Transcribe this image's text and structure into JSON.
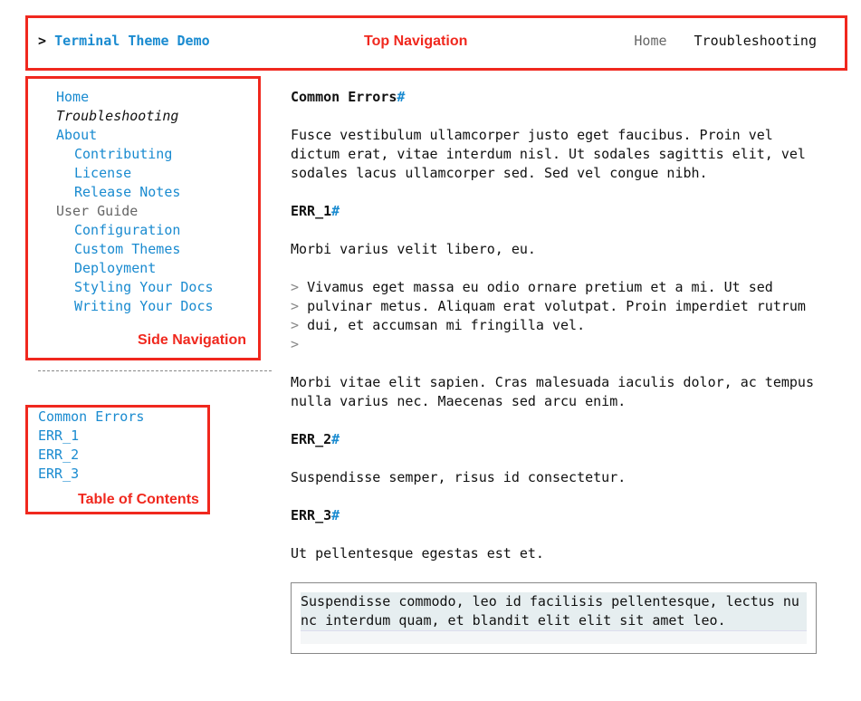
{
  "top_nav": {
    "prompt": ">",
    "brand": "Terminal Theme Demo",
    "links": [
      "Home",
      "Troubleshooting"
    ],
    "annotation": "Top Navigation"
  },
  "side_nav": {
    "items": [
      {
        "label": "Home",
        "level": 0,
        "kind": "link"
      },
      {
        "label": "Troubleshooting",
        "level": 0,
        "kind": "current"
      },
      {
        "label": "About",
        "level": 0,
        "kind": "link"
      },
      {
        "label": "Contributing",
        "level": 1,
        "kind": "link"
      },
      {
        "label": "License",
        "level": 1,
        "kind": "link"
      },
      {
        "label": "Release Notes",
        "level": 1,
        "kind": "link"
      },
      {
        "label": "User Guide",
        "level": 0,
        "kind": "group"
      },
      {
        "label": "Configuration",
        "level": 1,
        "kind": "link"
      },
      {
        "label": "Custom Themes",
        "level": 1,
        "kind": "link"
      },
      {
        "label": "Deployment",
        "level": 1,
        "kind": "link"
      },
      {
        "label": "Styling Your Docs",
        "level": 1,
        "kind": "link"
      },
      {
        "label": "Writing Your Docs",
        "level": 1,
        "kind": "link"
      }
    ],
    "annotation": "Side Navigation"
  },
  "toc": {
    "items": [
      "Common Errors",
      "ERR_1",
      "ERR_2",
      "ERR_3"
    ],
    "annotation": "Table of Contents"
  },
  "content": {
    "anchor": "#",
    "h_common": "Common Errors",
    "p_common": "Fusce vestibulum ullamcorper justo eget faucibus. Proin vel dictum erat, vitae interdum nisl. Ut sodales sagittis elit, vel sodales lacus ullamcorper sed. Sed vel congue nibh.",
    "h_err1": "ERR_1",
    "p_err1": "Morbi varius velit libero, eu.",
    "quote_marker": ">",
    "quote_lines": [
      "Vivamus eget massa eu odio ornare pretium et a mi. Ut sed",
      "pulvinar metus. Aliquam erat volutpat. Proin imperdiet rutrum",
      "dui, et accumsan mi fringilla vel.",
      ""
    ],
    "p_err1b": "Morbi vitae elit sapien. Cras malesuada iaculis dolor, ac tempus nulla varius nec. Maecenas sed arcu enim.",
    "h_err2": "ERR_2",
    "p_err2": "Suspendisse semper, risus id consectetur.",
    "h_err3": "ERR_3",
    "p_err3": "Ut pellentesque egestas est et.",
    "code": "Suspendisse commodo, leo id facilisis pellentesque, lectus nunc interdum quam, et blandit elit elit sit amet leo."
  },
  "colors": {
    "link": "#1a8bd0",
    "annotation": "#f0281e",
    "muted": "#666666"
  }
}
